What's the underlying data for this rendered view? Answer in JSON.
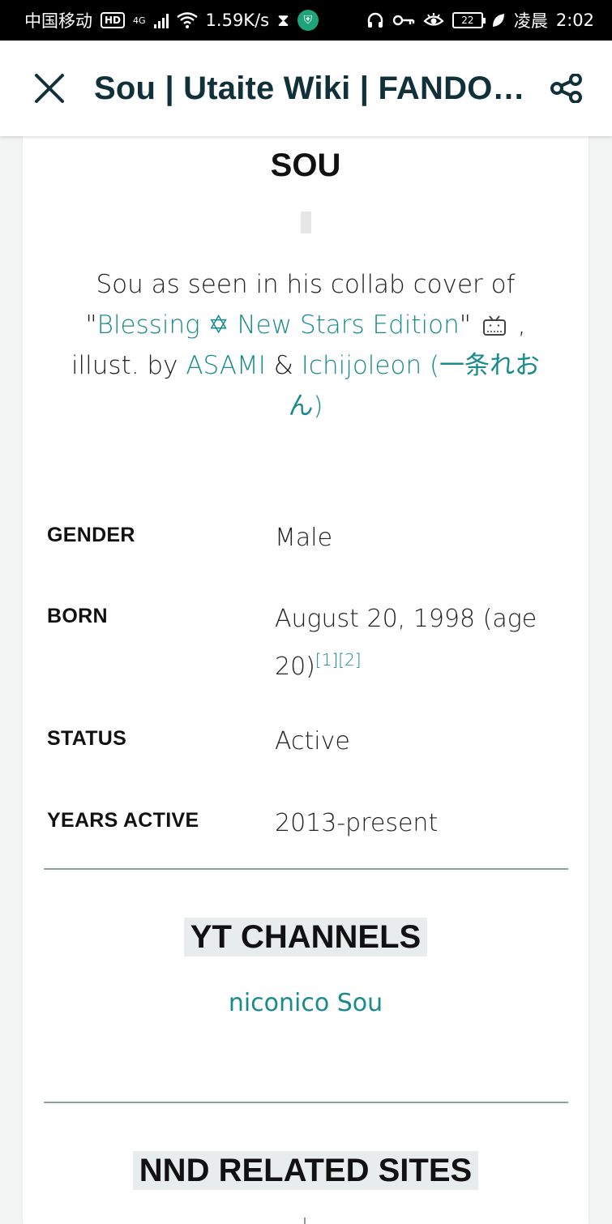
{
  "status_bar": {
    "carrier": "中国移动",
    "hd_badge": "HD",
    "network": "4G",
    "speed": "1.59K/s",
    "hourglass": "⧗",
    "battery_level": "22",
    "period": "凌晨",
    "time": "2:02",
    "icons": [
      "signal-icon",
      "wifi-icon",
      "hourglass-icon",
      "shield-icon",
      "headphones-icon",
      "key-icon",
      "eye-icon",
      "battery-icon",
      "leaf-icon"
    ]
  },
  "app_bar": {
    "title": "Sou | Utaite Wiki | FANDO…"
  },
  "infobox": {
    "title": "SOU",
    "caption": {
      "part1": "Sou as seen in his collab cover of",
      "quote_open": "\"",
      "link_blessing": "Blessing ✡ New Stars Edition",
      "quote_close": "\"",
      "comma": " ,",
      "illust_by": "illust. by ",
      "link_asami": "ASAMI",
      "amp": " & ",
      "link_ichijoleon": "Ichijoleon (一条れおん)"
    },
    "rows": [
      {
        "label": "GENDER",
        "value": "Male"
      },
      {
        "label": "BORN",
        "value": "August 20, 1998 (age 20)",
        "refs": "[1][2]"
      },
      {
        "label": "STATUS",
        "value": "Active"
      },
      {
        "label": "YEARS ACTIVE",
        "value": "2013-present"
      }
    ]
  },
  "sections": {
    "yt_channels": {
      "heading": "YT CHANNELS",
      "link": "niconico Sou"
    },
    "nnd_sites": {
      "heading": "NND RELATED SITES"
    }
  },
  "colors": {
    "link": "#1a8b8c",
    "title_text": "#10303a",
    "divider": "#8fa3a3",
    "section_bg": "#e9ecec",
    "page_bg": "#f2f3f3"
  }
}
